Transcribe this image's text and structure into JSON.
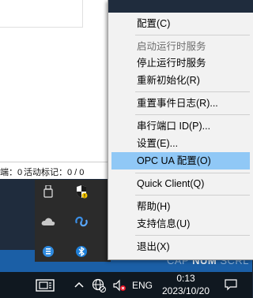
{
  "app_window": {
    "status_left": "端：0",
    "status_right": "活动标记：0 / 0"
  },
  "desktop_indicators": {
    "cap": "CAP",
    "num": "NUM",
    "scrl": "SCRL"
  },
  "context_menu": {
    "items": [
      {
        "label": "配置(C)",
        "enabled": true
      },
      {
        "label": "启动运行时服务",
        "enabled": false
      },
      {
        "label": "停止运行时服务",
        "enabled": true
      },
      {
        "label": "重新初始化(R)",
        "enabled": true
      },
      {
        "label": "重置事件日志(R)...",
        "enabled": true
      },
      {
        "label": "串行端口 ID(P)...",
        "enabled": true
      },
      {
        "label": "设置(E)...",
        "enabled": true
      },
      {
        "label": "OPC UA 配置(O)",
        "enabled": true,
        "highlighted": true
      },
      {
        "label": "Quick Client(Q)",
        "enabled": true
      },
      {
        "label": "帮助(H)",
        "enabled": true
      },
      {
        "label": "支持信息(U)",
        "enabled": true
      },
      {
        "label": "退出(X)",
        "enabled": true
      }
    ]
  },
  "taskbar": {
    "language": "ENG",
    "time": "0:13",
    "date": "2023/10/20"
  },
  "tray_icons": [
    "usb-drive-icon",
    "security-shield-icon",
    "onedrive-cloud-icon",
    "kepserver-icon",
    "app-blue-icon",
    "bluetooth-icon"
  ],
  "colors": {
    "menu_highlight": "#90c8f6",
    "taskbar": "#101820",
    "menu_background": "#f2f2f2"
  }
}
